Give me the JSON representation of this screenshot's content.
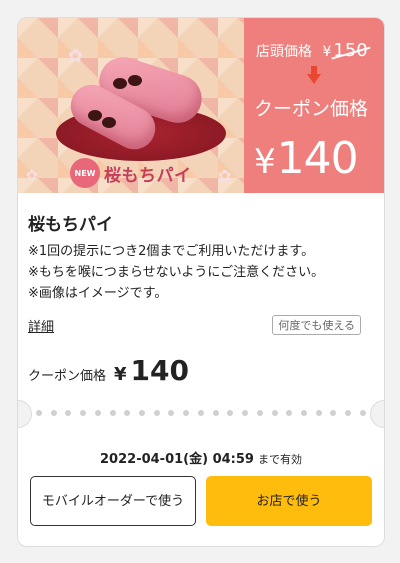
{
  "banner": {
    "logo_badge": "NEW",
    "logo_text": "桜もちパイ",
    "store_price_label": "店頭価格",
    "store_price_yen": "¥",
    "store_price_old": "150",
    "coupon_price_label": "クーポン価格",
    "coupon_price_yen": "¥",
    "coupon_price_value": "140",
    "colors": {
      "panel": "#ee7f7c",
      "arrow": "#e8482f"
    }
  },
  "item": {
    "title": "桜もちパイ",
    "notes": [
      "※1回の提示につき2個までご利用いただけます。",
      "※もちを喉につまらせないようにご注意ください。",
      "※画像はイメージです。"
    ],
    "detail_link": "詳細",
    "reuse_badge": "何度でも使える",
    "price_label": "クーポン価格",
    "price_yen": "¥",
    "price_value": "140"
  },
  "validity": {
    "date": "2022-04-01(金) 04:59",
    "suffix": "まで有効"
  },
  "buttons": {
    "mobile_order": "モバイルオーダーで使う",
    "in_store": "お店で使う",
    "in_store_color": "#ffbc0d"
  }
}
